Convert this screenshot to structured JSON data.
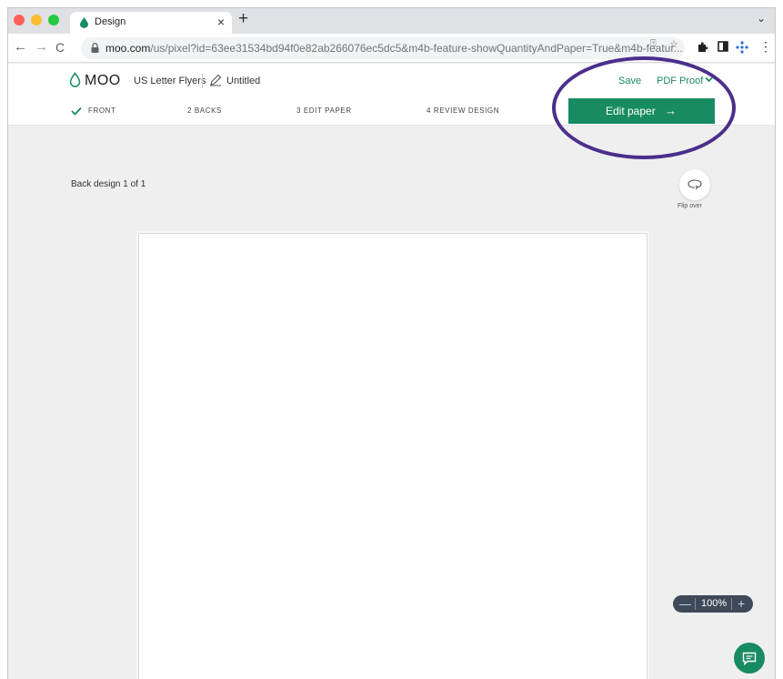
{
  "browser": {
    "tab_title": "Design",
    "tab_close": "×",
    "new_tab": "+",
    "tab_menu": "⌄",
    "back": "←",
    "forward": "→",
    "reload": "C",
    "url_host": "moo.com",
    "url_path": "/us/pixel?id=63ee31534bd94f0e82ab266076ec5dc5&m4b-feature-showQuantityAndPaper=True&m4b-featur..."
  },
  "header": {
    "logo_text": "MOO",
    "product": "US Letter Flyers",
    "doc_title": "Untitled",
    "save": "Save",
    "pdf_proof": "PDF Proof"
  },
  "steps": [
    {
      "label": "FRONT",
      "done": true
    },
    {
      "label": "2 BACKS"
    },
    {
      "label": "3 EDIT PAPER"
    },
    {
      "label": "4 REVIEW DESIGN"
    }
  ],
  "edit_paper": {
    "label": "Edit paper",
    "arrow": "→"
  },
  "canvas": {
    "back_design": "Back design 1 of 1",
    "flip_label": "Flip over"
  },
  "zoom": {
    "minus": "—",
    "value": "100%",
    "plus": "+"
  },
  "colors": {
    "brand_green": "#198b62",
    "annotation_purple": "#4b2f8c",
    "zoom_bg": "#3e4a5a"
  }
}
